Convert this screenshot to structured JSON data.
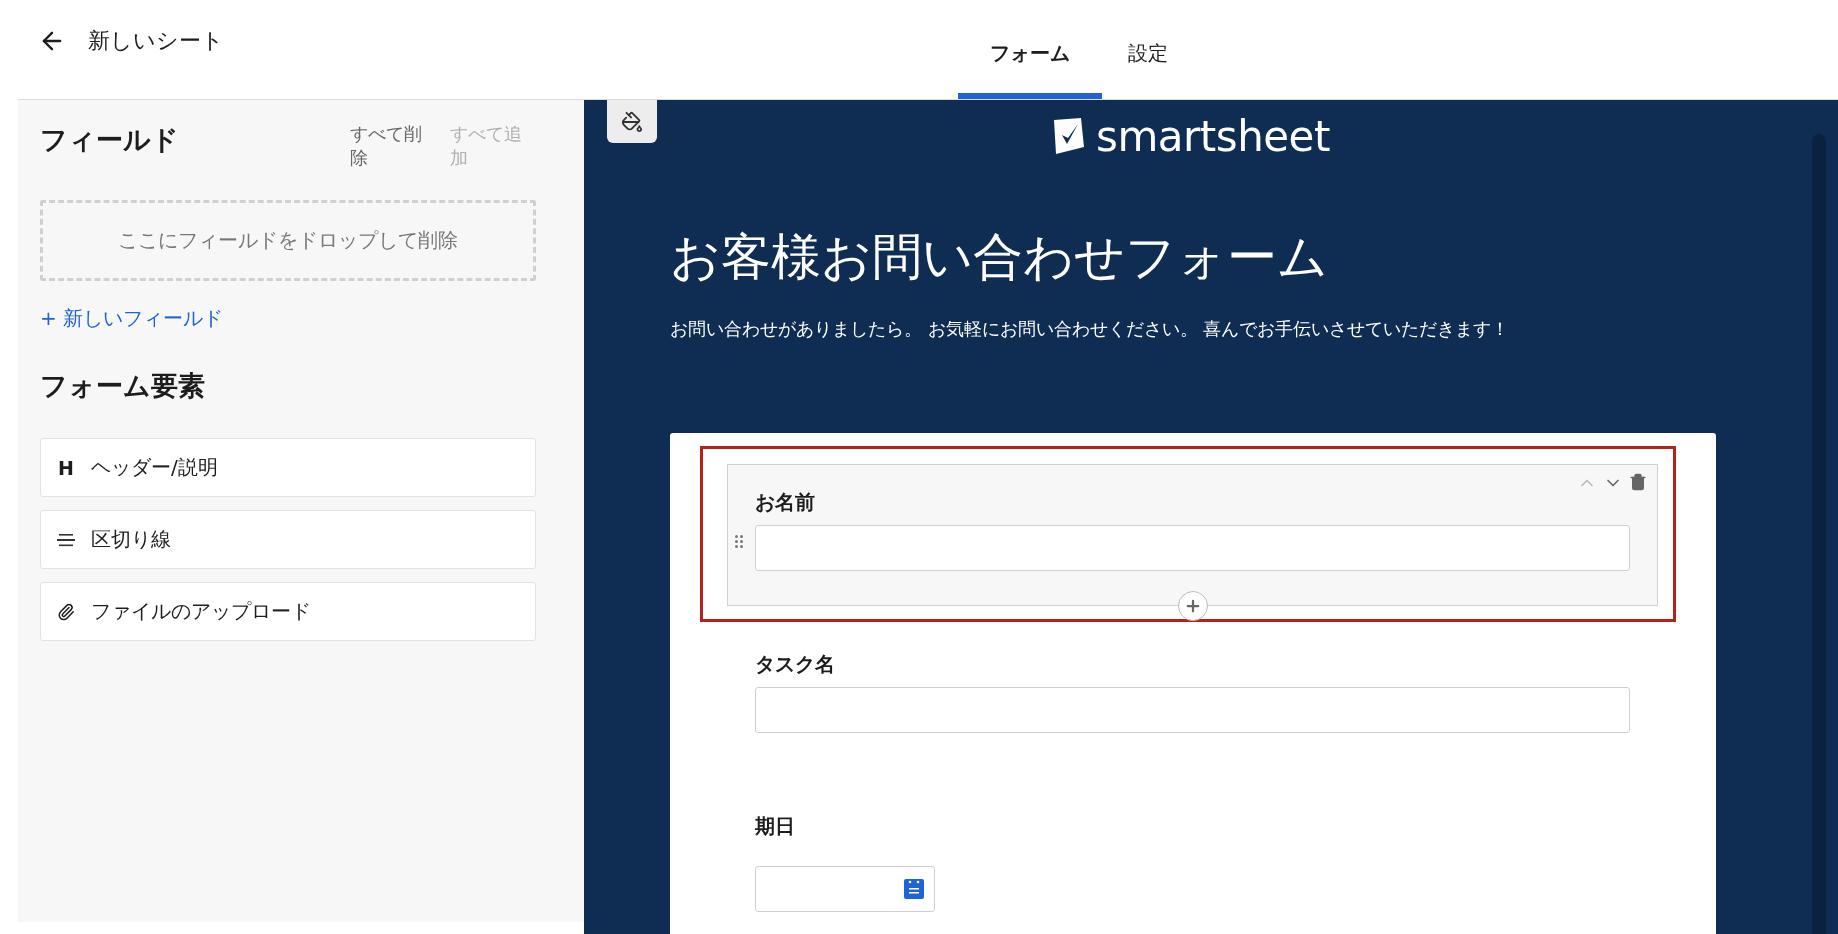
{
  "header": {
    "title": "新しいシート"
  },
  "tabs": [
    {
      "label": "フォーム",
      "selected": true
    },
    {
      "label": "設定",
      "selected": false
    }
  ],
  "sidebar": {
    "fields_heading": "フィールド",
    "actions": [
      {
        "label": "すべて削除",
        "disabled": false
      },
      {
        "label": "すべて追加",
        "disabled": true
      }
    ],
    "drop_zone": "ここにフィールドをドロップして削除",
    "new_field_link": "+ 新しいフィールド",
    "elements_heading": "フォーム要素",
    "elements": [
      {
        "kind": "header",
        "icon": "H",
        "label": "ヘッダー/説明"
      },
      {
        "kind": "divider",
        "label": "区切り線"
      },
      {
        "kind": "attachment",
        "label": "ファイルのアップロード"
      }
    ]
  },
  "form": {
    "logo": "smartsheet",
    "title": "お客様お問い合わせフォーム",
    "description": "お問い合わせがありましたら。 お気軽にお問い合わせください。 喜んでお手伝いさせていただきます！",
    "fields": [
      {
        "kind": "text",
        "label": "お名前",
        "selected": true
      },
      {
        "kind": "text",
        "label": "タスク名",
        "selected": false
      },
      {
        "kind": "date",
        "label": "期日",
        "selected": false
      }
    ]
  }
}
